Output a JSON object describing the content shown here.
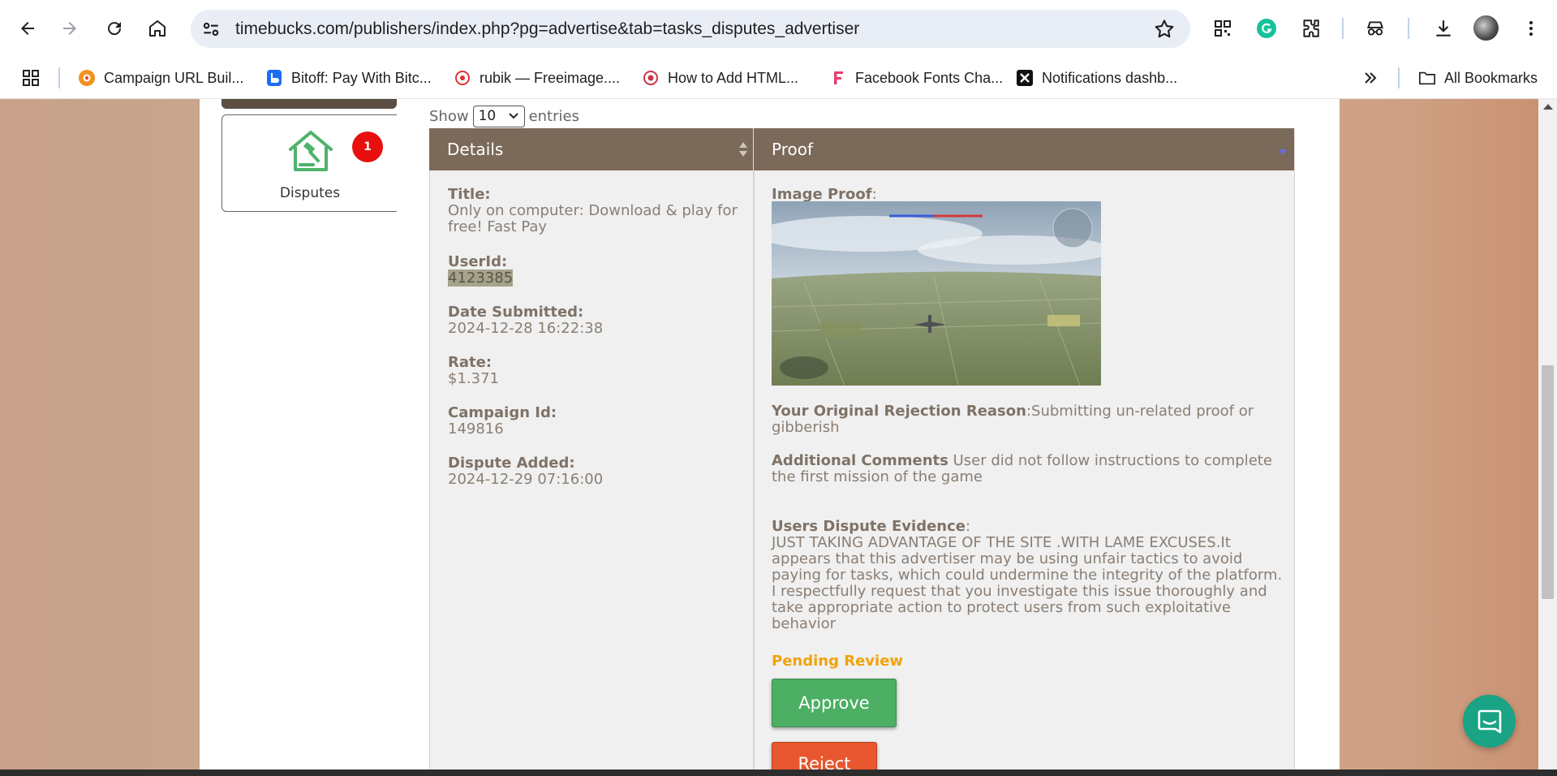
{
  "browser": {
    "url": "timebucks.com/publishers/index.php?pg=advertise&tab=tasks_disputes_advertiser",
    "bookmarks": [
      {
        "label": "Campaign URL Buil...",
        "icon": "campaign-icon"
      },
      {
        "label": "Bitoff: Pay With Bitc...",
        "icon": "bitoff-icon"
      },
      {
        "label": "rubik — Freeimage....",
        "icon": "freeimage-icon"
      },
      {
        "label": "How to Add HTML...",
        "icon": "html-icon"
      },
      {
        "label": "Facebook Fonts Cha...",
        "icon": "fonts-icon"
      },
      {
        "label": "Notifications dashb...",
        "icon": "notifications-icon"
      }
    ],
    "all_bookmarks": "All Bookmarks",
    "colors": {
      "omnibox": "#e9eef6",
      "grammarly": "#15c39a"
    }
  },
  "sidebar": {
    "item_label": "Disputes",
    "badge_count": "1",
    "icon": "house-gavel-icon"
  },
  "table": {
    "show_label": "Show",
    "entries_value": "10",
    "entries_label": "entries",
    "columns": [
      "Details",
      "Proof"
    ],
    "header_color": "#7b6a5a"
  },
  "details": {
    "title_label": "Title:",
    "title_value": "Only on computer: Download & play for free! Fast Pay",
    "userid_label": "UserId:",
    "userid_value": "4123385",
    "date_submitted_label": "Date Submitted:",
    "date_submitted_value": "2024-12-28 16:22:38",
    "rate_label": "Rate:",
    "rate_value": "$1.371",
    "campaign_id_label": "Campaign Id:",
    "campaign_id_value": "149816",
    "dispute_added_label": "Dispute Added:",
    "dispute_added_value": "2024-12-29 07:16:00"
  },
  "proof": {
    "image_proof_label": "Image Proof",
    "image_proof_colon": ":",
    "rejection_label": "Your Original Rejection Reason",
    "rejection_value": ":Submitting un-related proof or gibberish",
    "comments_label": "Additional Comments",
    "comments_value": " User did not follow instructions to complete the first mission of the game",
    "evidence_label": "Users Dispute Evidence",
    "evidence_colon": ":",
    "evidence_value": "JUST TAKING ADVANTAGE OF THE SITE .WITH LAME EXCUSES.It appears that this advertiser may be using unfair tactics to avoid paying for tasks, which could undermine the integrity of the platform. I respectfully request that you investigate this issue thoroughly and take appropriate action to protect users from such exploitative behavior",
    "status": "Pending Review",
    "approve_label": "Approve",
    "reject_label": "Reject",
    "status_color": "#f0a30a",
    "approve_color": "#4caf64",
    "reject_color": "#e8572f"
  }
}
